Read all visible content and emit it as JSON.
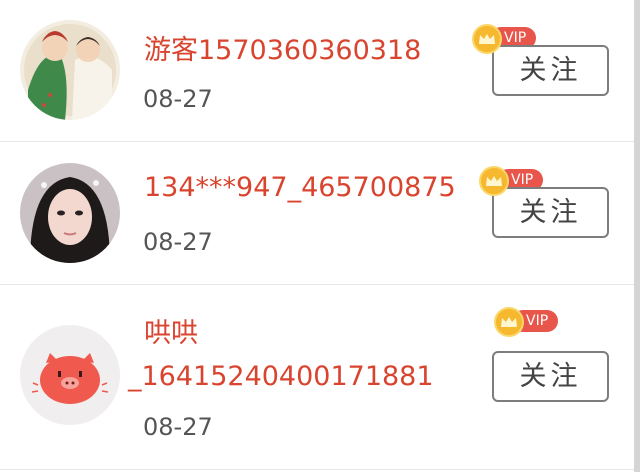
{
  "users": [
    {
      "name": "游客1570360360318",
      "date": "08-27",
      "badge": "VIP",
      "follow_label": "关注",
      "avatar": "cartoon-couple-avatar"
    },
    {
      "name": "134***947_465700875",
      "date": "08-27",
      "badge": "VIP",
      "follow_label": "关注",
      "avatar": "woman-photo-avatar"
    },
    {
      "name_line1": "哄哄",
      "name_line2": "_16415240400171881",
      "date": "08-27",
      "badge": "VIP",
      "follow_label": "关注",
      "avatar": "pink-pig-avatar"
    }
  ],
  "colors": {
    "name": "#d9442f",
    "vip": "#e8554a",
    "crown": "#f5b82e"
  }
}
